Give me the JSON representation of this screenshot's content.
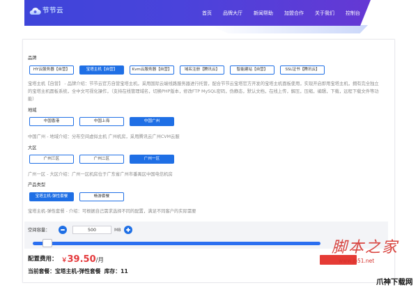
{
  "colors": {
    "accent": "#1f6fe5",
    "price": "#e4393c",
    "header_start": "#3e45d9",
    "header_end": "#6538d4",
    "buy_button": "#e53b35",
    "watermark": "#d5302b",
    "panel": "#f3f4f7"
  },
  "icons": {
    "logo": "cloud-icon",
    "decrease": "minus-icon",
    "increase": "plus-icon"
  },
  "header": {
    "logo_text": "节节云",
    "nav": [
      {
        "label": "首页"
      },
      {
        "label": "品牌大厅"
      },
      {
        "label": "新闻帮助"
      },
      {
        "label": "加盟合作"
      },
      {
        "label": "关于我们"
      },
      {
        "label": "控制台"
      }
    ]
  },
  "groups": [
    {
      "label": "品牌",
      "options": [
        {
          "label": "HY云服务器【自营】",
          "selected": false
        },
        {
          "label": "宝塔主机【自营】",
          "selected": true
        },
        {
          "label": "Kvm云服务器【自营】",
          "selected": false
        },
        {
          "label": "域名注册【腾讯云】",
          "selected": false
        },
        {
          "label": "智能建站【自营】",
          "selected": false
        },
        {
          "label": "SSL证书【腾讯云】",
          "selected": false
        }
      ],
      "description": "宝塔主机【自营】 - 品牌介绍：节节云官方自营宝塔主机，采用国际云端线路服务器进行托管，配合节节云宝塔官方开发的宝塔主机面板使用，实现开启即用宝塔主机，拥有完全独立的宝塔主机面板系统，全中文可视化操作，（支持在线管理域名，切换PHP版本，修改FTP MySQL密码，伪静态，默认文档，在线上传，解压，压缩，编辑，下载，远程下载文件等功能）"
    },
    {
      "label": "地域",
      "options": [
        {
          "label": "中国香港",
          "selected": false
        },
        {
          "label": "中国上海",
          "selected": false
        },
        {
          "label": "中国广州",
          "selected": true
        }
      ],
      "description": "中国广州 - 地域介绍：分布空间虚拟主机 广州机房，采用腾讯云广州CVM云服"
    },
    {
      "label": "大区",
      "options": [
        {
          "label": "广州三区",
          "selected": false
        },
        {
          "label": "广州二区",
          "selected": false
        },
        {
          "label": "广州一区",
          "selected": true
        }
      ],
      "description": "广州一区 - 大区介绍：广州一区机房位于广东省广州市番禺区中国电信机房"
    },
    {
      "label": "产品类型",
      "options": [
        {
          "label": "宝塔主机-弹性套餐",
          "selected": true
        },
        {
          "label": "畅游套餐",
          "selected": false
        }
      ],
      "description": "宝塔主机-弹性套餐 - 介绍：可根据自己需求选择不同的配置，满足不同客户的实际需要"
    }
  ],
  "capacity": {
    "label": "空间容量：",
    "value": "500",
    "unit": "MB",
    "slider_fraction": 0.05
  },
  "summary": {
    "price_label": "配置费用：",
    "currency": "￥",
    "price": "39.50",
    "period": "/月",
    "plan_label": "当前套餐：",
    "plan": "宝塔主机-弹性套餐",
    "stock_label": "库存：",
    "stock": "11"
  },
  "watermark": {
    "brand": "脚本之家",
    "url": "www.jb51.net",
    "corner_logo": "爪神下载网"
  }
}
